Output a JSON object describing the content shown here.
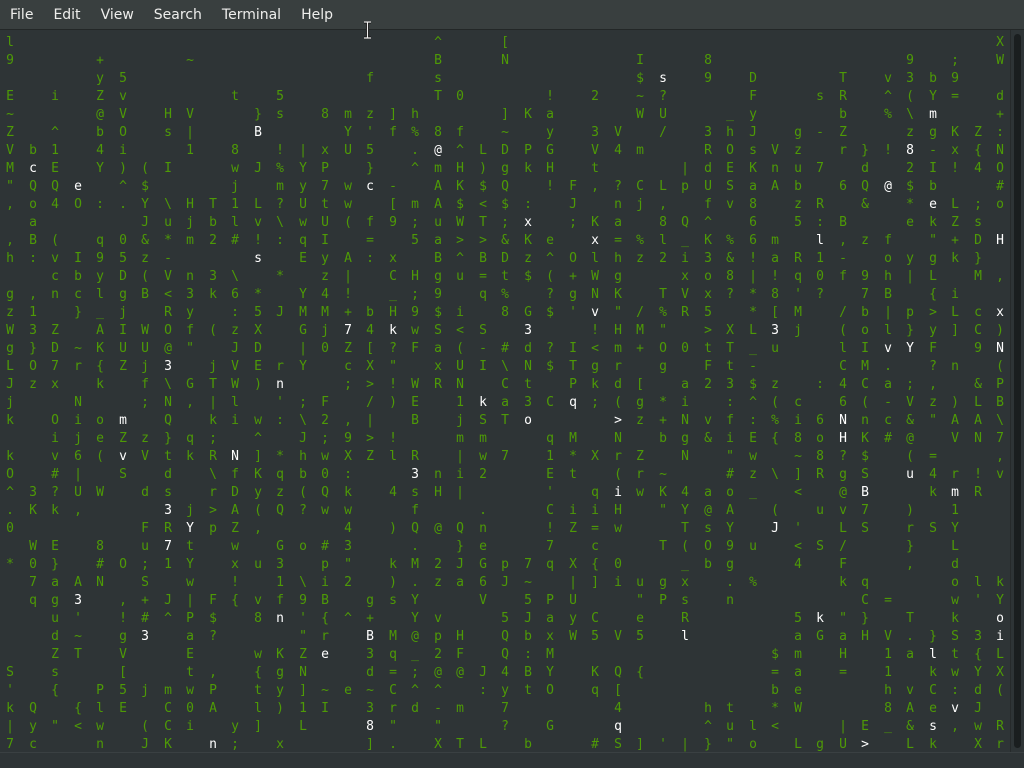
{
  "menu": {
    "file": "File",
    "edit": "Edit",
    "view": "View",
    "search": "Search",
    "terminal": "Terminal",
    "help": "Help"
  },
  "colors": {
    "terminal_bg": "#2e3436",
    "rain_green": "#4e9a06",
    "rain_bright": "#ffffff",
    "menubar_bg": "#393f3f"
  },
  "icons": {
    "cursor": "text-cursor-icon"
  },
  "rain": {
    "charset": "ABCDEFGHIJKLMNOPQRSTUVWXYZabcdefghijklmnopqrstuvwxyz0123456789@#$%&*+=!?;:<>()[]{}/\\^_'\"~,.-|",
    "bright_chars": [
      ">",
      "e",
      "3",
      "Z",
      "H",
      "q",
      "m",
      "Y",
      "d",
      "J",
      "7",
      "u",
      "8",
      "x",
      "o",
      "v",
      "n",
      "R",
      "B",
      "f",
      "l",
      "5",
      "N",
      "@",
      "k",
      "c",
      "i",
      "s"
    ]
  }
}
